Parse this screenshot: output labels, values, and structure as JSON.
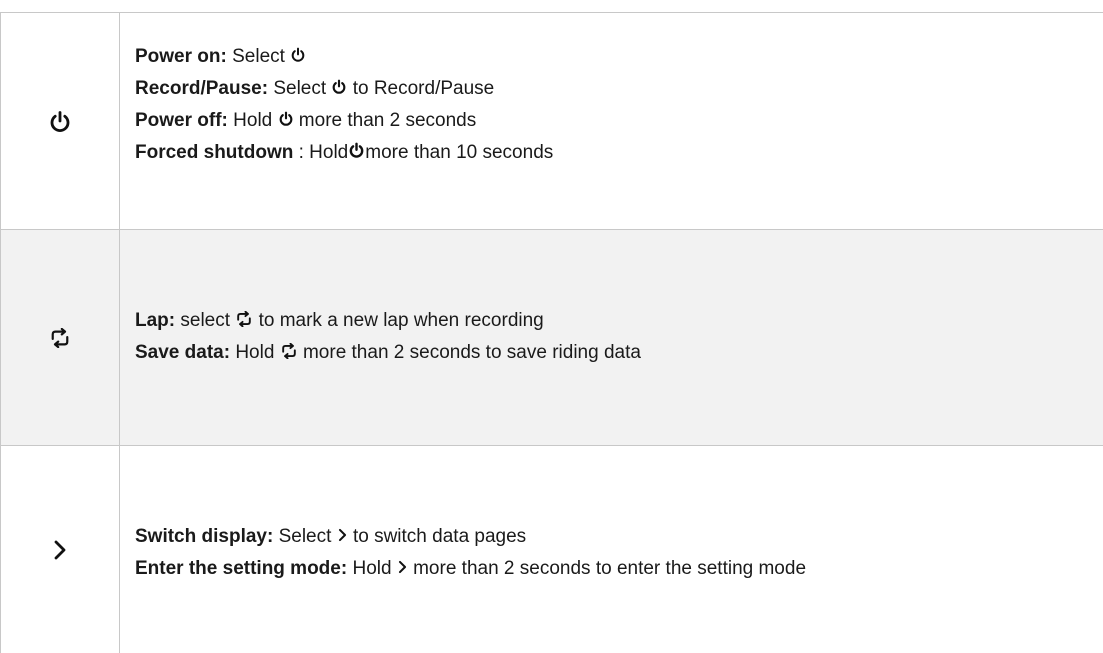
{
  "rows": [
    {
      "icon": "power-icon",
      "lines": [
        {
          "label": "Power on:",
          "before": " Select ",
          "icon": "power-icon",
          "after": ""
        },
        {
          "label": "Record/Pause:",
          "before": " Select ",
          "icon": "power-icon",
          "after": " to Record/Pause"
        },
        {
          "label": "Power off:",
          "before": " Hold ",
          "icon": "power-icon",
          "after": " more than 2 seconds"
        },
        {
          "label": "Forced shutdown",
          "before": " : Hold",
          "icon": "power-icon",
          "after": "more than 10 seconds"
        }
      ]
    },
    {
      "icon": "lap-loop-icon",
      "lines": [
        {
          "label": "Lap:",
          "before": " select ",
          "icon": "lap-loop-icon",
          "after": " to mark a new lap when recording"
        },
        {
          "label": "Save data:",
          "before": " Hold ",
          "icon": "lap-loop-icon",
          "after": " more than 2 seconds to save riding data"
        }
      ]
    },
    {
      "icon": "chevron-right-icon",
      "lines": [
        {
          "label": "Switch display:",
          "before": " Select ",
          "icon": "chevron-right-icon",
          "after": " to switch data pages"
        },
        {
          "label": "Enter the setting mode:",
          "before": " Hold ",
          "icon": "chevron-right-icon",
          "after": "  more than 2 seconds to enter the setting mode"
        }
      ]
    }
  ]
}
